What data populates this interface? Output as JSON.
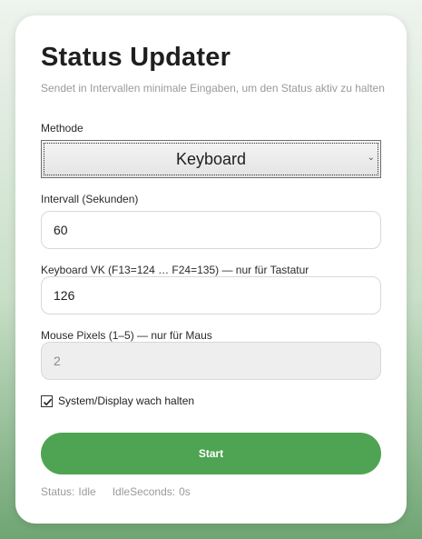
{
  "app": {
    "title": "Status Updater",
    "subtitle": "Sendet in Intervallen minimale Eingaben, um den Status aktiv zu halten"
  },
  "method": {
    "label": "Methode",
    "selected": "Keyboard"
  },
  "interval": {
    "label": "Intervall (Sekunden)",
    "value": "60"
  },
  "keyboard_vk": {
    "label": "Keyboard VK (F13=124 … F24=135) — nur für Tastatur",
    "value": "126"
  },
  "mouse_pixels": {
    "label": "Mouse Pixels (1–5) — nur für Maus",
    "value": "2",
    "disabled": true
  },
  "keep_awake": {
    "label": "System/Display wach halten",
    "checked": true
  },
  "start_button": {
    "label": "Start",
    "color": "#4ea452"
  },
  "status": {
    "status_label": "Status:",
    "status_value": "Idle",
    "idle_label": "IdleSeconds:",
    "idle_value": "0s"
  }
}
